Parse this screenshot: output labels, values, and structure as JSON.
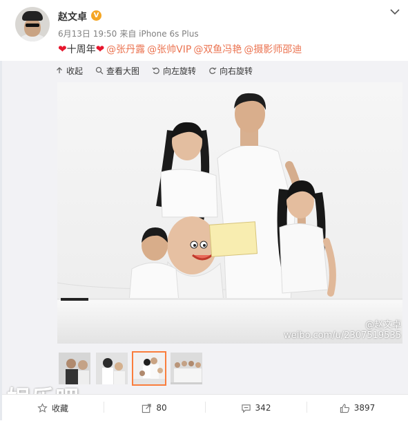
{
  "post": {
    "author": "赵文卓",
    "verified_badge": "V",
    "date": "6月13日 19:50",
    "source": "来自 iPhone 6s Plus",
    "text": "十周年",
    "mentions": [
      "@张丹露",
      "@张帅VIP",
      "@双鱼冯艳",
      "@摄影师邵迪"
    ]
  },
  "toolbar": {
    "collapse": "收起",
    "view_large": "查看大图",
    "rotate_left": "向左旋转",
    "rotate_right": "向右旋转"
  },
  "photo": {
    "watermark_name": "@赵文卓",
    "watermark_url": "weibo.com/u/2307519535"
  },
  "thumbnails": {
    "count": 4,
    "active_index": 2
  },
  "site_logo": "娱乐吧",
  "actions": {
    "favorite": "收藏",
    "repost": "80",
    "comments": "342",
    "likes": "3897"
  },
  "colors": {
    "accent": "#eb7350",
    "heart": "#e6162d",
    "verified": "#f5a623",
    "active_thumb": "#fa7d3c"
  }
}
